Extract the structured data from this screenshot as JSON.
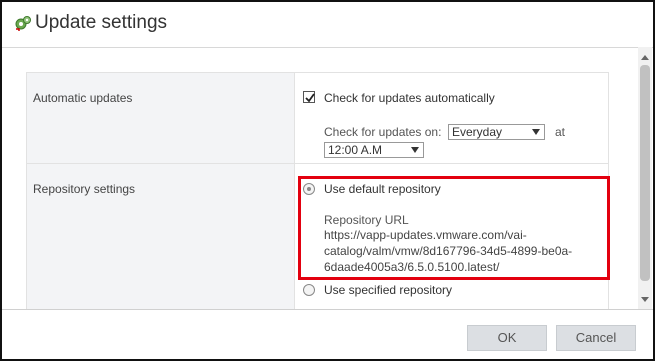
{
  "dialog": {
    "title": "Update settings",
    "icon": "update-settings-icon"
  },
  "automatic_updates": {
    "label": "Automatic updates",
    "check_label": "Check for updates automatically",
    "checked": true,
    "schedule_prefix": "Check for updates on:",
    "frequency": "Everyday",
    "at_label": "at",
    "time": "12:00 A.M"
  },
  "repository_settings": {
    "label": "Repository settings",
    "default_option": "Use default repository",
    "default_selected": true,
    "url_label": "Repository URL",
    "url_lines": [
      "https://vapp-updates.vmware.com/vai-",
      "catalog/valm/vmw/8d167796-34d5-4899-be0a-",
      "6daade4005a3/6.5.0.5100.latest/"
    ],
    "specified_option": "Use specified repository",
    "specified_selected": false
  },
  "footer": {
    "ok_label": "OK",
    "cancel_label": "Cancel"
  },
  "colors": {
    "highlight": "#e3000f",
    "label_bg": "#f3f4f6",
    "button_bg": "#dcdfe3"
  }
}
